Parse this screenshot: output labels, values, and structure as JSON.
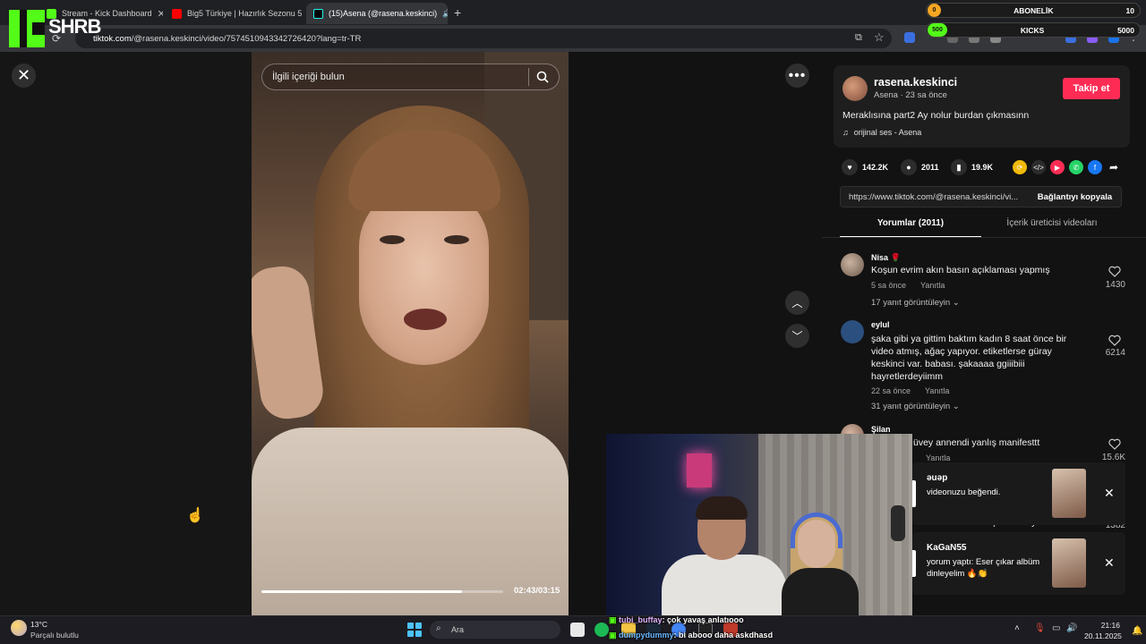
{
  "browser": {
    "tabs": [
      {
        "label": "Stream - Kick Dashboard",
        "active": false,
        "icon": "kick-icon"
      },
      {
        "label": "Big5 Türkiye | Hazırlık Sezonu 5",
        "active": false,
        "icon": "youtube-icon"
      },
      {
        "label": "(15)Asena (@rasena.keskinci)",
        "active": true,
        "icon": "tiktok-icon"
      }
    ],
    "url_domain": "tiktok.com",
    "url_path": "/@rasena.keskinci/video/7574510943342726420?lang=tr-TR",
    "new_tab": "+"
  },
  "overlay": {
    "brand_text": "SHRB",
    "abonelik_label": "ABONELİK",
    "abonelik_value": "10",
    "abonelik_badge": "0",
    "kicks_label": "KICKS",
    "kicks_value": "5000",
    "kicks_badge": "500"
  },
  "video": {
    "search_placeholder": "İlgili içeriği bulun",
    "time": "02:43/03:15",
    "progress": 0.83
  },
  "post": {
    "username": "rasena.keskinci",
    "meta": "Asena · 23 sa önce",
    "follow_label": "Takip et",
    "caption": "Meraklısına part2 Ay nolur burdan çıkmasınn",
    "music": "orijinal ses - Asena",
    "likes": "142.2K",
    "comments": "2011",
    "saves": "19.9K",
    "link": "https://www.tiktok.com/@rasena.keskinci/vi...",
    "copy_label": "Bağlantıyı kopyala",
    "tab_comments": "Yorumlar (2011)",
    "tab_creator": "İçerik üreticisi videoları"
  },
  "comments": [
    {
      "name": "Nisa 🌹",
      "text": "Koşun evrim akın basın açıklaması yapmış",
      "time": "5 sa önce",
      "reply": "Yanıtla",
      "replies": "17 yanıt görüntüleyin",
      "likes": "1430"
    },
    {
      "name": "eylul",
      "text": "şaka gibi ya gittim baktım kadın 8 saat önce bir video atmış, ağaç yapıyor. etiketlerse güray keskinci var. babası. şakaaaa ggiiibiii hayretlerdeyiimm",
      "time": "22 sa önce",
      "reply": "Yanıtla",
      "replies": "31 yanıt görüntüleyin",
      "likes": "6214"
    },
    {
      "name": "Şilan",
      "text": "üvey annendi yanlış manifesttt",
      "time": "",
      "reply": "Yanıtla",
      "replies": "",
      "likes": "15.6K"
    }
  ],
  "partial_comment": {
    "text": "...esi hde bezen içinde kallıyordu.",
    "likes": "1382"
  },
  "notifications": [
    {
      "user": "əuəp",
      "body": "videonuzu beğendi."
    },
    {
      "user": "KaGaN55",
      "body": "yorum yaptı: Eser çıkar albüm dinleyelim 🔥👏"
    }
  ],
  "chat": [
    {
      "user": "tubi_buffay",
      "msg": ": çok yavaş anlatıooo"
    },
    {
      "user": "dumpydummy",
      "msg": ": bi abooo daha askdhasd"
    }
  ],
  "taskbar": {
    "temp": "13°C",
    "weather": "Parçalı bulutlu",
    "search": "Ara",
    "time": "21:16",
    "date": "20.11.2025"
  },
  "colors": {
    "accent": "#fe2c55",
    "kick": "#53fc18"
  }
}
